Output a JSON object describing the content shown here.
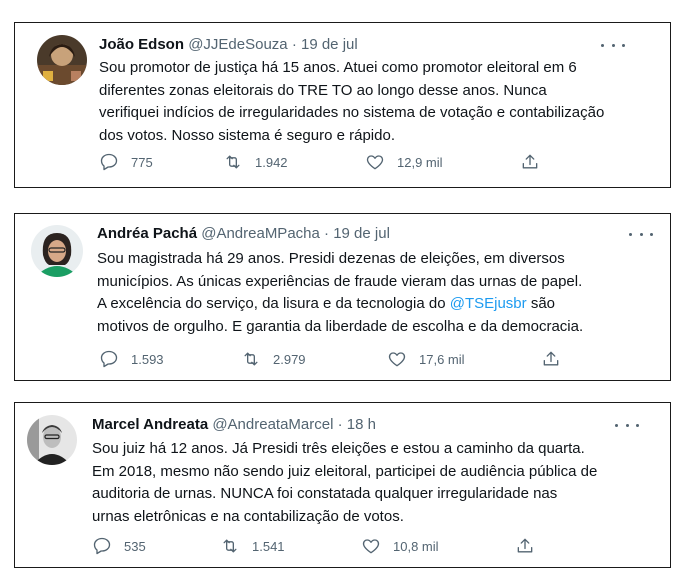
{
  "tweets": [
    {
      "name": "João Edson",
      "handle": "@JJEdeSouza",
      "sep": "·",
      "time": "19 de jul",
      "lines": [
        "Sou promotor de justiça há 15 anos. Atuei como promotor eleitoral em 6",
        "diferentes zonas eleitorais do TRE TO ao longo desse anos. Nunca",
        "verifiquei indícios de irregularidades no sistema de votação e contabilização",
        "dos votos. Nosso sistema é seguro e rápido."
      ],
      "replies": "775",
      "retweets": "1.942",
      "likes": "12,9 mil",
      "avatar_colors": [
        "#6b4a2e",
        "#c8a27a"
      ]
    },
    {
      "name": "Andréa Pachá",
      "handle": "@AndreaMPacha",
      "sep": "·",
      "time": "19 de jul",
      "lines": [
        "Sou magistrada há 29 anos. Presidi dezenas de eleições, em diversos",
        "municípios. As únicas experiências de fraude vieram das urnas de papel.",
        "A excelência do serviço, da lisura e da tecnologia do",
        "motivos de orgulho. E garantia da liberdade de escolha e da democracia."
      ],
      "mention": "@TSEjusbr",
      "line3_tail": "são",
      "replies": "1.593",
      "retweets": "2.979",
      "likes": "17,6 mil",
      "avatar_colors": [
        "#1a9e63",
        "#2b2320"
      ]
    },
    {
      "name": "Marcel Andreata",
      "handle": "@AndreataMarcel",
      "sep": "·",
      "time": "18 h",
      "lines": [
        "Sou juiz há 12 anos. Já Presidi três eleições e estou a caminho da quarta.",
        "Em 2018, mesmo não sendo juiz eleitoral, participei de audiência pública de",
        "auditoria de urnas. NUNCA foi constatada qualquer irregularidade nas",
        "urnas eletrônicas e na contabilização de votos."
      ],
      "replies": "535",
      "retweets": "1.541",
      "likes": "10,8 mil",
      "avatar_colors": [
        "#3a3a3a",
        "#e6e6e6"
      ]
    }
  ],
  "icons": {
    "reply": "reply-icon",
    "retweet": "retweet-icon",
    "like": "like-icon",
    "share": "share-icon",
    "more": "more-icon"
  },
  "colors": {
    "text": "#0f1419",
    "secondary": "#536471",
    "link": "#1d9bf0",
    "border": "#1a1a1a"
  }
}
